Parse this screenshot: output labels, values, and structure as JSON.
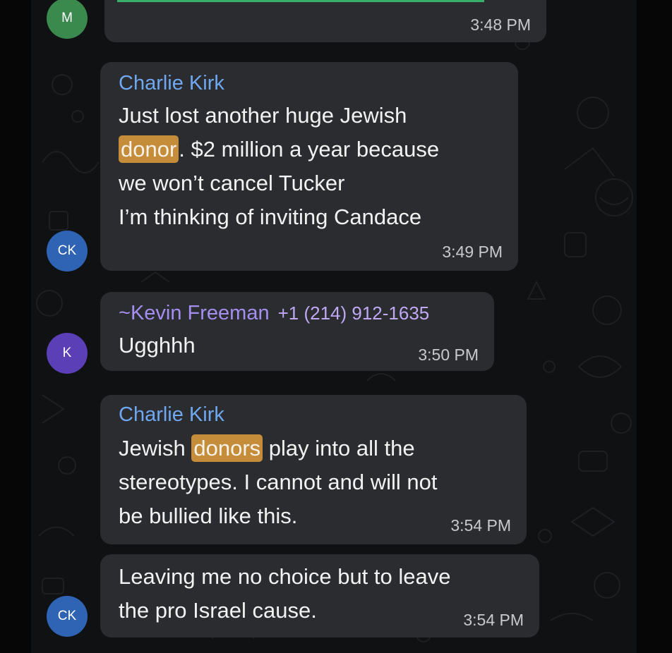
{
  "chat": {
    "messages": [
      {
        "avatar": "M",
        "time": "3:48 PM"
      },
      {
        "avatar": "CK",
        "sender": "Charlie Kirk",
        "lines": [
          {
            "before": "Just lost another huge Jewish",
            "highlight": "",
            "after": ""
          },
          {
            "before": "",
            "highlight": "donor",
            "after": ". $2 million a year because"
          },
          {
            "before": "we won’t cancel Tucker",
            "highlight": "",
            "after": ""
          },
          {
            "before": "I’m thinking of inviting Candace",
            "highlight": "",
            "after": ""
          }
        ],
        "time": "3:49 PM"
      },
      {
        "avatar": "K",
        "sender_prefix": "~",
        "sender": "Kevin Freeman",
        "phone": "+1 (214) 912-1635",
        "lines": [
          {
            "before": "Ugghhh",
            "highlight": "",
            "after": ""
          }
        ],
        "time": "3:50 PM"
      },
      {
        "sender": "Charlie Kirk",
        "lines": [
          {
            "before": "Jewish ",
            "highlight": "donors",
            "after": " play into all the"
          },
          {
            "before": "stereotypes. I cannot and will not",
            "highlight": "",
            "after": ""
          },
          {
            "before": "be bullied like this.",
            "highlight": "",
            "after": ""
          }
        ],
        "time": "3:54 PM"
      },
      {
        "avatar": "CK",
        "lines": [
          {
            "before": "Leaving me no choice but to leave",
            "highlight": "",
            "after": ""
          },
          {
            "before": "the pro Israel cause.",
            "highlight": "",
            "after": ""
          }
        ],
        "time": "3:54 PM"
      }
    ]
  },
  "colors": {
    "background": "#101113",
    "bubble": "#2a2c30",
    "sender_blue": "#6fa8f0",
    "sender_purple": "#a48ef0",
    "highlight": "#c58d3a",
    "avatar_green": "#3a8a4e",
    "avatar_blue": "#2f63b4",
    "avatar_purple": "#5a3fb6"
  }
}
